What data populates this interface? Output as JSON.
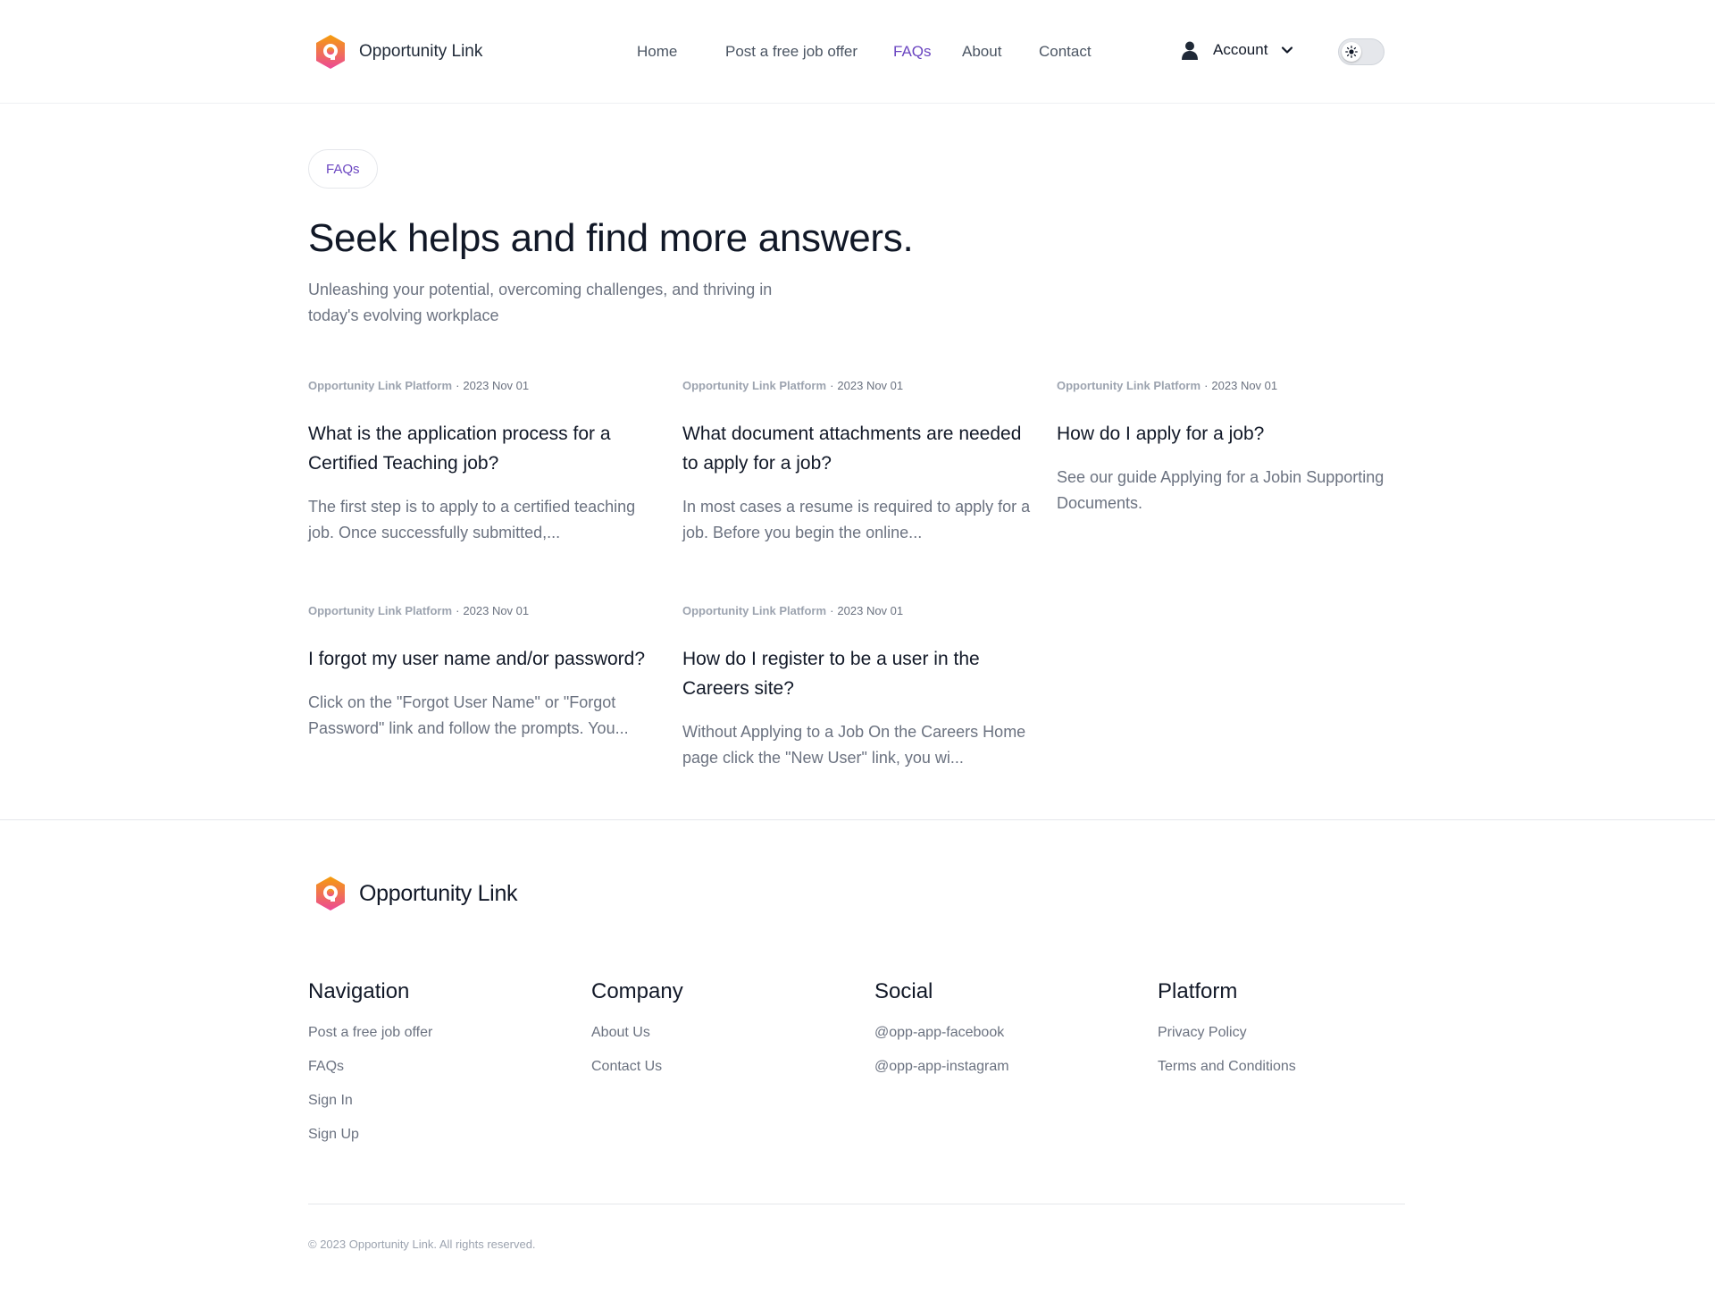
{
  "brand": {
    "name": "Opportunity Link",
    "logo_icon": "hexagon-q-logo-icon",
    "colors": {
      "gradient_top": "#f59e0b",
      "gradient_bottom": "#ec4899",
      "accent": "#6b46c1"
    }
  },
  "nav": {
    "items": [
      {
        "label": "Home"
      },
      {
        "label": "Post a free job offer"
      },
      {
        "label": "FAQs",
        "active": true
      },
      {
        "label": "About"
      },
      {
        "label": "Contact"
      }
    ],
    "account_label": "Account",
    "account_icon": "user-icon",
    "account_chevron": "chevron-down-icon",
    "theme_toggle_icon": "sun-icon",
    "theme_toggle_on": false
  },
  "hero": {
    "badge": "FAQs",
    "title": "Seek helps and find more answers.",
    "subtitle": "Unleashing your potential, overcoming challenges, and thriving in today's evolving workplace"
  },
  "articles": [
    {
      "source": "Opportunity Link Platform",
      "date": "2023 Nov 01",
      "title": "What is the application process for a Certified Teaching job?",
      "excerpt": "The first step is to apply to a certified teaching job. Once successfully submitted,..."
    },
    {
      "source": "Opportunity Link Platform",
      "date": "2023 Nov 01",
      "title": "What document attachments are needed to apply for a job?",
      "excerpt": "In most cases a resume is required to apply for a job. Before you begin the online..."
    },
    {
      "source": "Opportunity Link Platform",
      "date": "2023 Nov 01",
      "title": "How do I apply for a job?",
      "excerpt": "See our guide Applying for a Jobin Supporting Documents."
    },
    {
      "source": "Opportunity Link Platform",
      "date": "2023 Nov 01",
      "title": "I forgot my user name and/or password?",
      "excerpt": "Click on the \"Forgot User Name\" or \"Forgot Password\" link and follow the prompts. You..."
    },
    {
      "source": "Opportunity Link Platform",
      "date": "2023 Nov 01",
      "title": "How do I register to be a user in the Careers site?",
      "excerpt": "Without Applying to a Job On the Careers Home page click the \"New User\" link, you wi..."
    }
  ],
  "footer": {
    "brand_name": "Opportunity Link",
    "columns": [
      {
        "heading": "Navigation",
        "links": [
          "Post a free job offer",
          "FAQs",
          "Sign In",
          "Sign Up"
        ]
      },
      {
        "heading": "Company",
        "links": [
          "About Us",
          "Contact Us"
        ]
      },
      {
        "heading": "Social",
        "links": [
          "@opp-app-facebook",
          "@opp-app-instagram"
        ]
      },
      {
        "heading": "Platform",
        "links": [
          "Privacy Policy",
          "Terms and Conditions"
        ]
      }
    ],
    "copyright": "© 2023 Opportunity Link. All rights reserved."
  }
}
